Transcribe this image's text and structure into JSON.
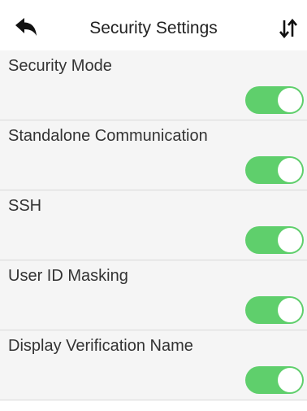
{
  "header": {
    "title": "Security Settings",
    "back_icon": "back-arrow-icon",
    "sort_icon": "sort-arrows-icon"
  },
  "settings": [
    {
      "label": "Security Mode",
      "enabled": true
    },
    {
      "label": "Standalone Communication",
      "enabled": true
    },
    {
      "label": "SSH",
      "enabled": true
    },
    {
      "label": "User ID Masking",
      "enabled": true
    },
    {
      "label": "Display Verification Name",
      "enabled": true
    }
  ],
  "colors": {
    "toggle_on": "#5fcf6c",
    "row_background": "#f5f5f5",
    "divider": "#d9d9d9"
  }
}
